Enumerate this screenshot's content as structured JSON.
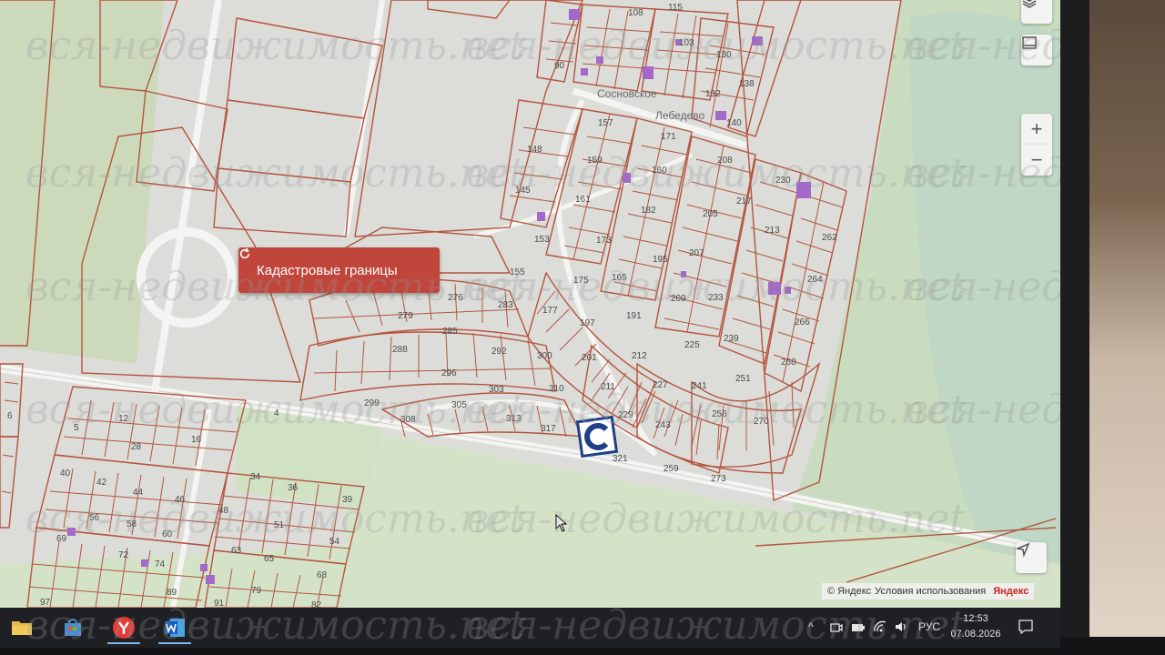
{
  "map": {
    "cadastral_button": {
      "label": "Кадастровые границы",
      "icon": "refresh-icon"
    },
    "place_labels": [
      "Сосновское",
      "Лебедево"
    ],
    "plot_numbers": [
      "108",
      "115",
      "90",
      "103",
      "130",
      "132",
      "138",
      "140",
      "157",
      "171",
      "148",
      "145",
      "159",
      "161",
      "160",
      "182",
      "208",
      "217",
      "230",
      "262",
      "153",
      "155",
      "173",
      "165",
      "195",
      "205",
      "207",
      "213",
      "264",
      "276",
      "279",
      "283",
      "285",
      "288",
      "292",
      "300",
      "296",
      "305",
      "303",
      "310",
      "313",
      "317",
      "299",
      "308",
      "321",
      "259",
      "273",
      "177",
      "175",
      "197",
      "191",
      "209",
      "201",
      "211",
      "212",
      "229",
      "227",
      "233",
      "225",
      "241",
      "243",
      "239",
      "251",
      "256",
      "270",
      "268",
      "266",
      "12",
      "16",
      "28",
      "40",
      "42",
      "44",
      "46",
      "48",
      "34",
      "36",
      "39",
      "51",
      "54",
      "56",
      "58",
      "60",
      "63",
      "65",
      "68",
      "69",
      "72",
      "74",
      "79",
      "82",
      "89",
      "91",
      "97",
      "5",
      "6",
      "4"
    ],
    "parcel_stroke": "#b4553e",
    "road_color": "#f4f4f2",
    "grass_color": "#c9dcc0",
    "plot_fill": "#e4e4e0",
    "purple_buildings": "#a368c8",
    "controls": {
      "layers": "layers-icon",
      "ruler": "ruler-icon",
      "zoom_in": "+",
      "zoom_out": "−",
      "locate": "navigation-arrow-icon"
    },
    "attribution": {
      "copyright": "© Яндекс",
      "terms": "Условия использования",
      "brand": "Яндекс"
    }
  },
  "taskbar": {
    "apps": [
      "folder-icon",
      "store-icon",
      "yandex-browser-icon",
      "word-icon"
    ],
    "tray": {
      "chevron": "^",
      "language": "РУС",
      "time": "12:53",
      "date": "07.08.2026"
    }
  },
  "watermark": "вся-недвижимость.net"
}
